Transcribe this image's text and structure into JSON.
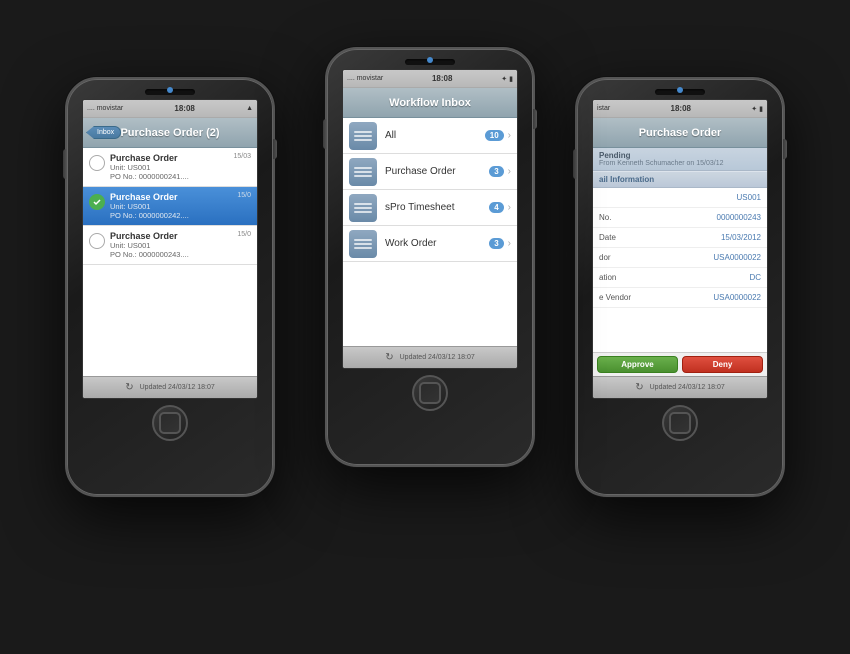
{
  "phones": {
    "left": {
      "carrier": ".... movistar",
      "time": "18:08",
      "title": "Purchase Order (2)",
      "back_label": "Inbox",
      "items": [
        {
          "title": "Purchase Order",
          "unit": "Unit: US001",
          "po": "PO No.: 0000000241....",
          "date": "15/03",
          "selected": false,
          "checked": false
        },
        {
          "title": "Purchase Order",
          "unit": "Unit: US001",
          "po": "PO No.: 0000000242....",
          "date": "15/0",
          "selected": true,
          "checked": true
        },
        {
          "title": "Purchase Order",
          "unit": "Unit: US001",
          "po": "PO No.: 0000000243....",
          "date": "15/0",
          "selected": false,
          "checked": false
        }
      ],
      "footer": "Updated 24/03/12 18:07"
    },
    "center": {
      "carrier": ".... movistar",
      "time": "18:08",
      "title": "Workflow Inbox",
      "items": [
        {
          "label": "All",
          "badge": "10"
        },
        {
          "label": "Purchase Order",
          "badge": "3"
        },
        {
          "label": "sPro Timesheet",
          "badge": "4"
        },
        {
          "label": "Work Order",
          "badge": "3"
        }
      ],
      "footer": "Updated 24/03/12 18:07"
    },
    "right": {
      "carrier": "istar",
      "time": "18:08",
      "title": "Purchase Order",
      "status": "Pending",
      "status_from": "From Kenneth Schumacher on 15/03/12",
      "section_header": "ail Information",
      "fields": [
        {
          "label": "",
          "value": "US001"
        },
        {
          "label": "No.",
          "value": "0000000243"
        },
        {
          "label": "Date",
          "value": "15/03/2012"
        },
        {
          "label": "dor",
          "value": "USA0000022"
        },
        {
          "label": "ation",
          "value": "DC"
        },
        {
          "label": "e Vendor",
          "value": "USA0000022"
        }
      ],
      "btn_approve": "Approve",
      "btn_deny": "Deny",
      "footer": "Updated 24/03/12 18:07"
    }
  }
}
